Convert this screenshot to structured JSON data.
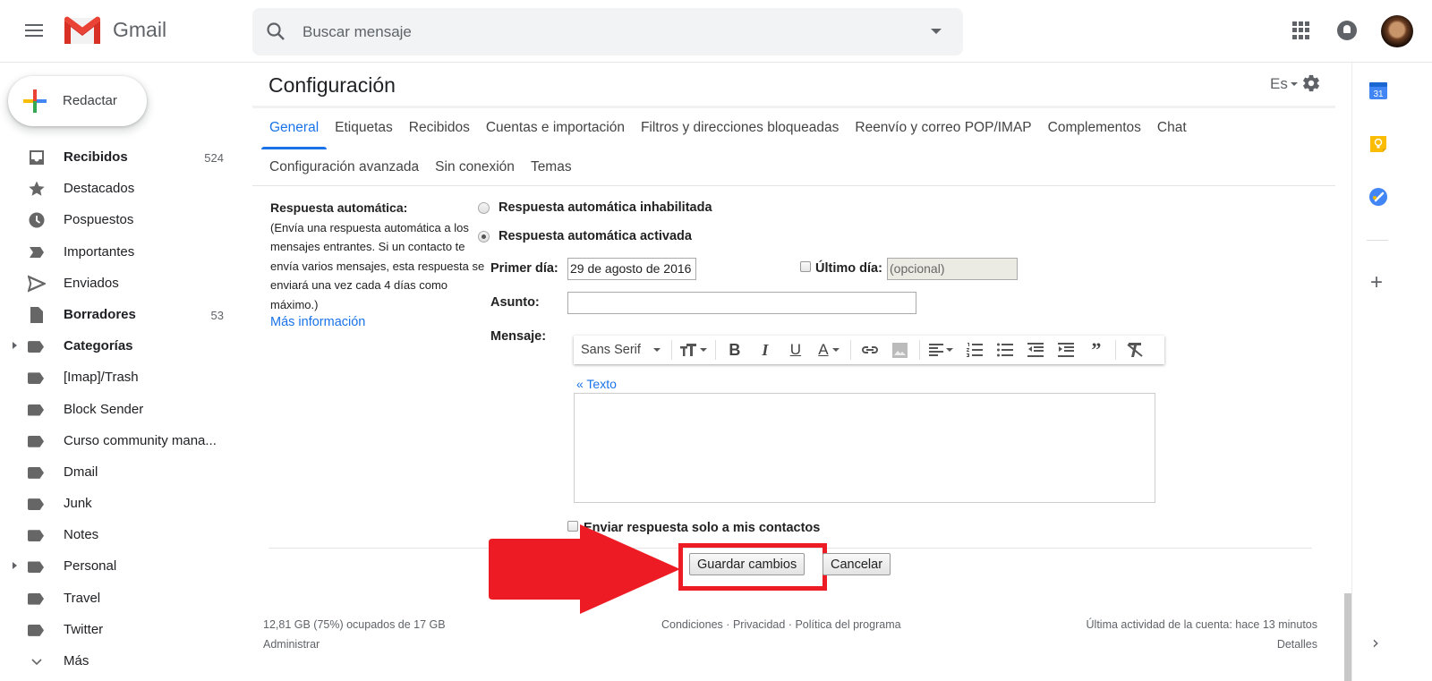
{
  "app": {
    "name": "Gmail"
  },
  "search": {
    "placeholder": "Buscar mensaje"
  },
  "compose": {
    "label": "Redactar"
  },
  "sidebar": {
    "items": [
      {
        "label": "Recibidos",
        "count": "524",
        "bold": true,
        "icon": "inbox-icon"
      },
      {
        "label": "Destacados",
        "count": "",
        "icon": "star-icon"
      },
      {
        "label": "Pospuestos",
        "count": "",
        "icon": "clock-icon"
      },
      {
        "label": "Importantes",
        "count": "",
        "icon": "important-icon"
      },
      {
        "label": "Enviados",
        "count": "",
        "icon": "send-icon"
      },
      {
        "label": "Borradores",
        "count": "53",
        "bold": true,
        "icon": "draft-icon"
      },
      {
        "label": "Categorías",
        "count": "",
        "bold": true,
        "icon": "label-icon",
        "expandable": true
      },
      {
        "label": "[Imap]/Trash",
        "count": "",
        "icon": "label-icon"
      },
      {
        "label": "Block Sender",
        "count": "",
        "icon": "label-icon"
      },
      {
        "label": "Curso community mana...",
        "count": "",
        "icon": "label-icon"
      },
      {
        "label": "Dmail",
        "count": "",
        "icon": "label-icon"
      },
      {
        "label": "Junk",
        "count": "",
        "icon": "label-icon"
      },
      {
        "label": "Notes",
        "count": "",
        "icon": "label-icon"
      },
      {
        "label": "Personal",
        "count": "",
        "icon": "label-icon",
        "expandable": true
      },
      {
        "label": "Travel",
        "count": "",
        "icon": "label-icon"
      },
      {
        "label": "Twitter",
        "count": "",
        "icon": "label-icon"
      },
      {
        "label": "Más",
        "count": "",
        "icon": "chevron-down-icon"
      }
    ]
  },
  "settings": {
    "title": "Configuración",
    "language": "Es",
    "tabs_row1": [
      "General",
      "Etiquetas",
      "Recibidos",
      "Cuentas e importación",
      "Filtros y direcciones bloqueadas",
      "Reenvío y correo POP/IMAP",
      "Complementos",
      "Chat"
    ],
    "tabs_row2": [
      "Configuración avanzada",
      "Sin conexión",
      "Temas"
    ],
    "active_tab": "General"
  },
  "autoreply": {
    "heading": "Respuesta automática:",
    "description": "(Envía una respuesta automática a los mensajes entrantes. Si un contacto te envía varios mensajes, esta respuesta se enviará una vez cada 4 días como máximo.)",
    "learn_more": "Más información",
    "option_off": "Respuesta automática inhabilitada",
    "option_on": "Respuesta automática activada",
    "selected": "on",
    "first_day_label": "Primer día:",
    "first_day_value": "29 de agosto de 2016",
    "last_day_label": "Último día:",
    "last_day_placeholder": "(opcional)",
    "last_day_checked": false,
    "subject_label": "Asunto:",
    "subject_value": "",
    "message_label": "Mensaje:",
    "font": "Sans Serif",
    "plain_text_link": "« Texto",
    "message_value": "",
    "contacts_only_label": "Enviar respuesta solo a mis contactos",
    "contacts_only_checked": false
  },
  "buttons": {
    "save": "Guardar cambios",
    "cancel": "Cancelar"
  },
  "footer": {
    "storage": "12,81 GB (75%) ocupados de 17 GB",
    "storage_percent": 75,
    "manage": "Administrar",
    "terms": "Condiciones",
    "privacy": "Privacidad",
    "policy": "Política del programa",
    "dot": "·",
    "last_activity": "Última actividad de la cuenta: hace 13 minutos",
    "details": "Detalles"
  },
  "rightbar": {
    "calendar_day": "31"
  },
  "colors": {
    "accent": "#1a73e8",
    "highlight": "#ed1c24"
  }
}
